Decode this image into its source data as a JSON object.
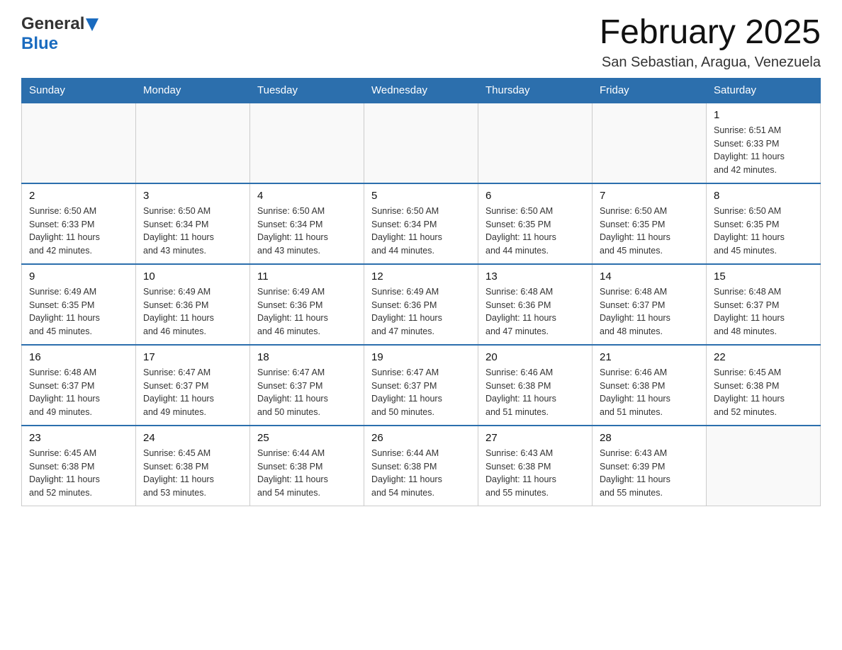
{
  "header": {
    "logo": {
      "general": "General",
      "blue": "Blue",
      "tagline": "GeneralBlue"
    },
    "title": "February 2025",
    "location": "San Sebastian, Aragua, Venezuela"
  },
  "weekdays": [
    "Sunday",
    "Monday",
    "Tuesday",
    "Wednesday",
    "Thursday",
    "Friday",
    "Saturday"
  ],
  "weeks": [
    [
      {
        "day": "",
        "info": ""
      },
      {
        "day": "",
        "info": ""
      },
      {
        "day": "",
        "info": ""
      },
      {
        "day": "",
        "info": ""
      },
      {
        "day": "",
        "info": ""
      },
      {
        "day": "",
        "info": ""
      },
      {
        "day": "1",
        "info": "Sunrise: 6:51 AM\nSunset: 6:33 PM\nDaylight: 11 hours\nand 42 minutes."
      }
    ],
    [
      {
        "day": "2",
        "info": "Sunrise: 6:50 AM\nSunset: 6:33 PM\nDaylight: 11 hours\nand 42 minutes."
      },
      {
        "day": "3",
        "info": "Sunrise: 6:50 AM\nSunset: 6:34 PM\nDaylight: 11 hours\nand 43 minutes."
      },
      {
        "day": "4",
        "info": "Sunrise: 6:50 AM\nSunset: 6:34 PM\nDaylight: 11 hours\nand 43 minutes."
      },
      {
        "day": "5",
        "info": "Sunrise: 6:50 AM\nSunset: 6:34 PM\nDaylight: 11 hours\nand 44 minutes."
      },
      {
        "day": "6",
        "info": "Sunrise: 6:50 AM\nSunset: 6:35 PM\nDaylight: 11 hours\nand 44 minutes."
      },
      {
        "day": "7",
        "info": "Sunrise: 6:50 AM\nSunset: 6:35 PM\nDaylight: 11 hours\nand 45 minutes."
      },
      {
        "day": "8",
        "info": "Sunrise: 6:50 AM\nSunset: 6:35 PM\nDaylight: 11 hours\nand 45 minutes."
      }
    ],
    [
      {
        "day": "9",
        "info": "Sunrise: 6:49 AM\nSunset: 6:35 PM\nDaylight: 11 hours\nand 45 minutes."
      },
      {
        "day": "10",
        "info": "Sunrise: 6:49 AM\nSunset: 6:36 PM\nDaylight: 11 hours\nand 46 minutes."
      },
      {
        "day": "11",
        "info": "Sunrise: 6:49 AM\nSunset: 6:36 PM\nDaylight: 11 hours\nand 46 minutes."
      },
      {
        "day": "12",
        "info": "Sunrise: 6:49 AM\nSunset: 6:36 PM\nDaylight: 11 hours\nand 47 minutes."
      },
      {
        "day": "13",
        "info": "Sunrise: 6:48 AM\nSunset: 6:36 PM\nDaylight: 11 hours\nand 47 minutes."
      },
      {
        "day": "14",
        "info": "Sunrise: 6:48 AM\nSunset: 6:37 PM\nDaylight: 11 hours\nand 48 minutes."
      },
      {
        "day": "15",
        "info": "Sunrise: 6:48 AM\nSunset: 6:37 PM\nDaylight: 11 hours\nand 48 minutes."
      }
    ],
    [
      {
        "day": "16",
        "info": "Sunrise: 6:48 AM\nSunset: 6:37 PM\nDaylight: 11 hours\nand 49 minutes."
      },
      {
        "day": "17",
        "info": "Sunrise: 6:47 AM\nSunset: 6:37 PM\nDaylight: 11 hours\nand 49 minutes."
      },
      {
        "day": "18",
        "info": "Sunrise: 6:47 AM\nSunset: 6:37 PM\nDaylight: 11 hours\nand 50 minutes."
      },
      {
        "day": "19",
        "info": "Sunrise: 6:47 AM\nSunset: 6:37 PM\nDaylight: 11 hours\nand 50 minutes."
      },
      {
        "day": "20",
        "info": "Sunrise: 6:46 AM\nSunset: 6:38 PM\nDaylight: 11 hours\nand 51 minutes."
      },
      {
        "day": "21",
        "info": "Sunrise: 6:46 AM\nSunset: 6:38 PM\nDaylight: 11 hours\nand 51 minutes."
      },
      {
        "day": "22",
        "info": "Sunrise: 6:45 AM\nSunset: 6:38 PM\nDaylight: 11 hours\nand 52 minutes."
      }
    ],
    [
      {
        "day": "23",
        "info": "Sunrise: 6:45 AM\nSunset: 6:38 PM\nDaylight: 11 hours\nand 52 minutes."
      },
      {
        "day": "24",
        "info": "Sunrise: 6:45 AM\nSunset: 6:38 PM\nDaylight: 11 hours\nand 53 minutes."
      },
      {
        "day": "25",
        "info": "Sunrise: 6:44 AM\nSunset: 6:38 PM\nDaylight: 11 hours\nand 54 minutes."
      },
      {
        "day": "26",
        "info": "Sunrise: 6:44 AM\nSunset: 6:38 PM\nDaylight: 11 hours\nand 54 minutes."
      },
      {
        "day": "27",
        "info": "Sunrise: 6:43 AM\nSunset: 6:38 PM\nDaylight: 11 hours\nand 55 minutes."
      },
      {
        "day": "28",
        "info": "Sunrise: 6:43 AM\nSunset: 6:39 PM\nDaylight: 11 hours\nand 55 minutes."
      },
      {
        "day": "",
        "info": ""
      }
    ]
  ]
}
